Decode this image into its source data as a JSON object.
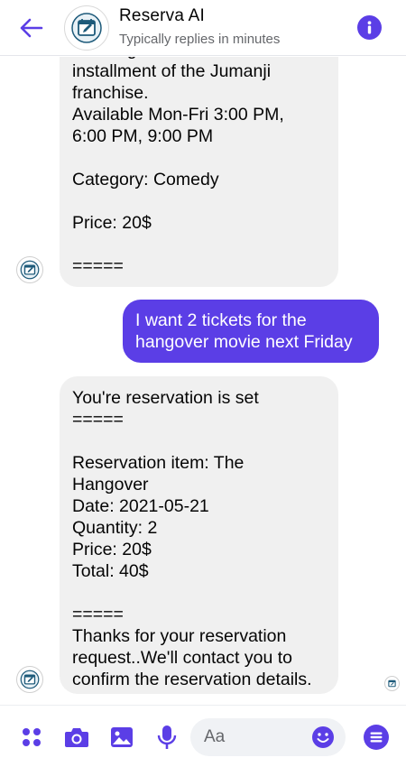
{
  "header": {
    "title": "Reserva  AI",
    "status": "Typically replies in minutes"
  },
  "messages": [
    {
      "sender": "bot",
      "text": "Alleburg and the first\ninstallment of the Jumanji\nfranchise.\nAvailable Mon-Fri 3:00 PM,\n6:00 PM, 9:00 PM\n\nCategory: Comedy\n\nPrice: 20$\n\n====="
    },
    {
      "sender": "user",
      "text": "I want 2 tickets for the\nhangover movie next Friday"
    },
    {
      "sender": "bot",
      "text": "You're reservation is set\n=====\n\nReservation item: The\nHangover\nDate: 2021-05-21\nQuantity: 2\nPrice: 20$\nTotal: 40$\n\n=====\nThanks for your reservation\nrequest..We'll contact you to\nconfirm the reservation details."
    }
  ],
  "composer": {
    "placeholder": "Aa"
  },
  "icons": {
    "back": "back-arrow-icon",
    "info": "info-icon",
    "menu": "grid-menu-icon",
    "camera": "camera-icon",
    "gallery": "image-icon",
    "mic": "microphone-icon",
    "emoji": "emoji-icon",
    "send": "list-menu-icon",
    "avatar": "calendar-edit-icon"
  },
  "colors": {
    "accent": "#5b3ee6",
    "bot_bubble": "#f0f0f0",
    "muted_text": "#65676b"
  }
}
